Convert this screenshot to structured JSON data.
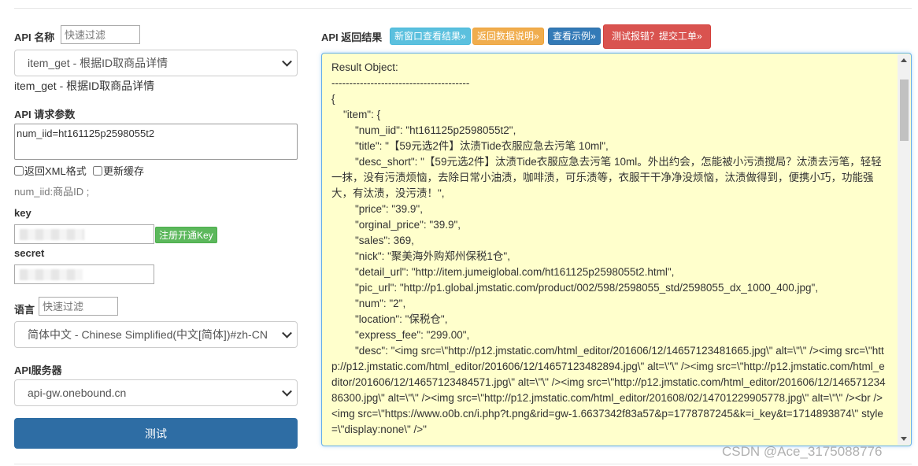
{
  "left": {
    "api_name_label": "API 名称",
    "api_name_filter_placeholder": "快速过滤",
    "api_select_value": "item_get - 根据ID取商品详情",
    "api_desc": "item_get - 根据ID取商品详情",
    "params_label": "API 请求参数",
    "params_value": "num_iid=ht161125p2598055t2",
    "xml_checkbox_label": "返回XML格式",
    "cache_checkbox_label": "更新缓存",
    "param_hint": "num_iid:商品ID ;",
    "key_label": "key",
    "register_button": "注册开通Key",
    "secret_label": "secret",
    "lang_label": "语言",
    "lang_filter_placeholder": "快速过滤",
    "lang_select_value": "简体中文 - Chinese Simplified(中文[简体])#zh-CN",
    "server_label": "API服务器",
    "server_select_value": "api-gw.onebound.cn",
    "test_button": "测试"
  },
  "right": {
    "result_label": "API 返回结果",
    "buttons": {
      "new_window": "新窗口查看结果»",
      "data_desc": "返回数据说明»",
      "example": "查看示例»",
      "report": "测试报错？提交工单»"
    },
    "result_text": "Result Object:\n---------------------------------------\n{\n\t\"item\": {\n\t\t\"num_iid\": \"ht161125p2598055t2\",\n\t\t\"title\": \"【59元选2件】汰渍Tide衣服应急去污笔 10ml\",\n\t\t\"desc_short\": \"【59元选2件】汰渍Tide衣服应急去污笔 10ml。外出约会，怎能被小污渍搅局？汰渍去污笔，轻轻一抹，没有污渍烦恼，去除日常小油渍，咖啡渍，可乐渍等，衣服干干净净没烦恼，汰渍做得到，便携小巧，功能强大，有汰渍，没污渍！\",\n\t\t\"price\": \"39.9\",\n\t\t\"orginal_price\": \"39.9\",\n\t\t\"sales\": 369,\n\t\t\"nick\": \"聚美海外购郑州保税1仓\",\n\t\t\"detail_url\": \"http://item.jumeiglobal.com/ht161125p2598055t2.html\",\n\t\t\"pic_url\": \"http://p1.global.jmstatic.com/product/002/598/2598055_std/2598055_dx_1000_400.jpg\",\n\t\t\"num\": \"2\",\n\t\t\"location\": \"保税仓\",\n\t\t\"express_fee\": \"299.00\",\n\t\t\"desc\": \"<img src=\\\"http://p12.jmstatic.com/html_editor/201606/12/14657123481665.jpg\\\" alt=\\\"\\\" /><img src=\\\"http://p12.jmstatic.com/html_editor/201606/12/14657123482894.jpg\\\" alt=\\\"\\\" /><img src=\\\"http://p12.jmstatic.com/html_editor/201606/12/14657123484571.jpg\\\" alt=\\\"\\\" /><img src=\\\"http://p12.jmstatic.com/html_editor/201606/12/14657123486300.jpg\\\" alt=\\\"\\\" /><img src=\\\"http://p12.jmstatic.com/html_editor/201608/02/14701229905778.jpg\\\" alt=\\\"\\\" /><br /><img src=\\\"https://www.o0b.cn/i.php?t.png&rid=gw-1.6637342f83a57&p=1778787245&k=i_key&t=1714893874\\\" style=\\\"display:none\\\" />\""
  },
  "watermark": "CSDN @Ace_3175088776",
  "colors": {
    "info": "#5bc0de",
    "warning": "#f0ad4e",
    "primary": "#337ab7",
    "danger": "#d9534f",
    "success": "#5cb85c",
    "test_button": "#2e6da4",
    "result_bg": "#ffffcc"
  }
}
